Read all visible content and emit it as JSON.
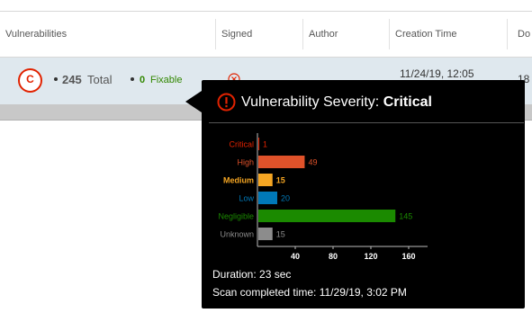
{
  "table": {
    "headers": [
      {
        "label": "Vulnerabilities"
      },
      {
        "label": "Signed"
      },
      {
        "label": "Author"
      },
      {
        "label": "Creation Time"
      },
      {
        "label": "Do"
      }
    ],
    "row": {
      "severity_badge": "C",
      "total_count": "245",
      "total_label": "Total",
      "fixable_count": "0",
      "fixable_label": "Fixable",
      "signed_icon": "x-circle-icon",
      "creation_time": "11/24/19, 12:05",
      "next_col_text": "18"
    }
  },
  "tooltip": {
    "title_prefix": "Vulnerability Severity:",
    "title_value": "Critical",
    "duration": "Duration: 23 sec",
    "scan_completed": "Scan completed time: 11/29/19, 3:02 PM"
  },
  "chart_data": {
    "type": "bar",
    "orientation": "horizontal",
    "categories": [
      "Critical",
      "High",
      "Medium",
      "Low",
      "Negligible",
      "Unknown"
    ],
    "values": [
      1,
      49,
      15,
      20,
      145,
      15
    ],
    "colors": [
      "#e12200",
      "#e0522a",
      "#f5a623",
      "#0079b8",
      "#1b8a00",
      "#8c8c8c"
    ],
    "xticks": [
      40,
      80,
      120,
      160
    ],
    "xlim": [
      0,
      180
    ],
    "grid": false
  },
  "colors": {
    "critical": "#e12200",
    "fixable": "#318700",
    "row_bg": "#dfe8ee"
  }
}
